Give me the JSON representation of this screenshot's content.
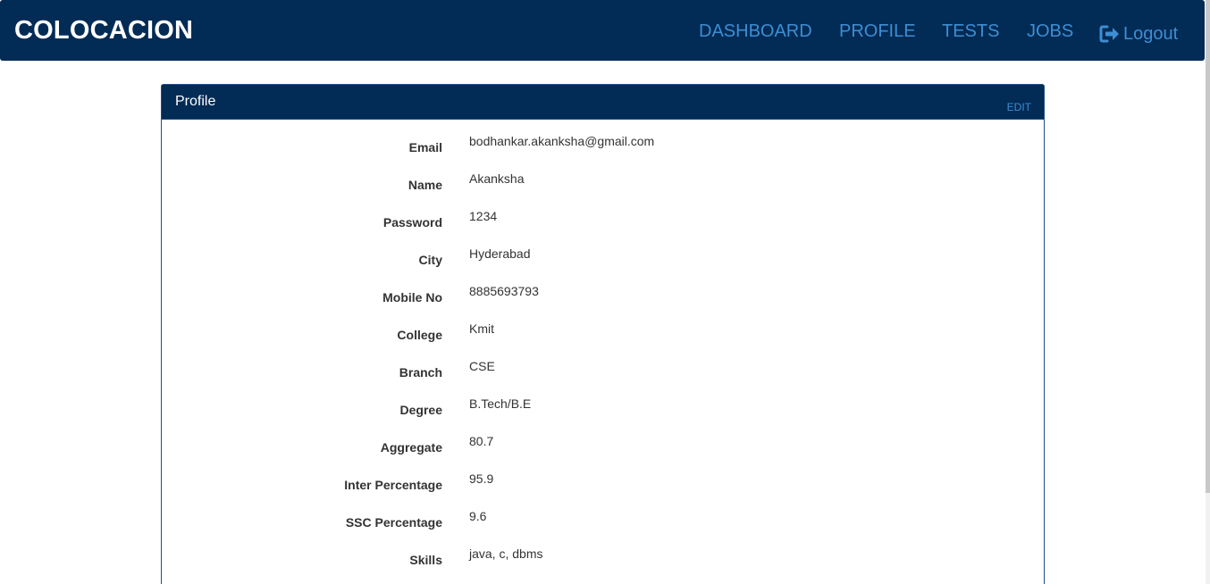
{
  "navbar": {
    "brand": "COLOCACION",
    "links": {
      "dashboard": "DASHBOARD",
      "profile": "PROFILE",
      "tests": "TESTS",
      "jobs": "JOBS",
      "logout": "Logout"
    },
    "colors": {
      "background": "#022b55",
      "link": "#3d8ed4"
    }
  },
  "panel": {
    "title": "Profile",
    "edit_label": "EDIT",
    "fields": [
      {
        "label": "Email",
        "value": "bodhankar.akanksha@gmail.com"
      },
      {
        "label": "Name",
        "value": "Akanksha"
      },
      {
        "label": "Password",
        "value": "1234"
      },
      {
        "label": "City",
        "value": "Hyderabad"
      },
      {
        "label": "Mobile No",
        "value": "8885693793"
      },
      {
        "label": "College",
        "value": "Kmit"
      },
      {
        "label": "Branch",
        "value": "CSE"
      },
      {
        "label": "Degree",
        "value": "B.Tech/B.E"
      },
      {
        "label": "Aggregate",
        "value": "80.7"
      },
      {
        "label": "Inter Percentage",
        "value": "95.9"
      },
      {
        "label": "SSC Percentage",
        "value": "9.6"
      },
      {
        "label": "Skills",
        "value": "java, c, dbms"
      }
    ]
  }
}
